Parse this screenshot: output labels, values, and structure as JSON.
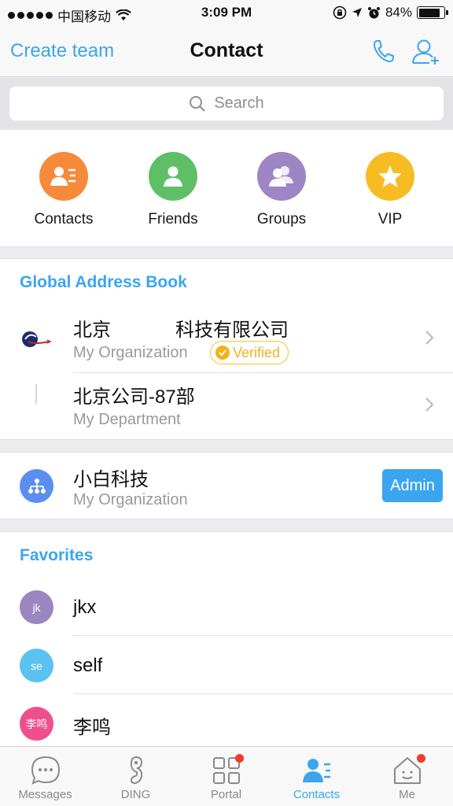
{
  "status_bar": {
    "carrier": "中国移动",
    "time": "3:09 PM",
    "battery_percent": "84%",
    "battery_level": 0.84,
    "icons": [
      "signal-dots-icon",
      "wifi-icon",
      "rotation-lock-icon",
      "location-icon",
      "alarm-icon",
      "battery-icon"
    ]
  },
  "nav": {
    "left_action": "Create team",
    "title": "Contact",
    "right_icons": [
      "phone-icon",
      "add-contact-icon"
    ]
  },
  "search": {
    "placeholder": "Search"
  },
  "quick_actions": [
    {
      "label": "Contacts",
      "color": "#f58a3a",
      "icon": "contacts-icon"
    },
    {
      "label": "Friends",
      "color": "#5fbf67",
      "icon": "friend-icon"
    },
    {
      "label": "Groups",
      "color": "#9c86c4",
      "icon": "groups-icon"
    },
    {
      "label": "VIP",
      "color": "#f6bc22",
      "icon": "star-icon"
    }
  ],
  "global_address_book": {
    "title": "Global Address Book",
    "items": [
      {
        "name_part1": "北京",
        "name_part2": "科技有限公司",
        "subtitle": "My Organization",
        "badge": "Verified"
      },
      {
        "name": "北京公司-87部",
        "subtitle": "My Department"
      }
    ]
  },
  "organization": {
    "name": "小白科技",
    "subtitle": "My Organization",
    "action": "Admin",
    "icon": "org-chart-icon",
    "icon_color": "#5b8ef0"
  },
  "favorites": {
    "title": "Favorites",
    "items": [
      {
        "avatar_text": "jk",
        "name": "jkx",
        "color": "#9a86c0"
      },
      {
        "avatar_text": "se",
        "name": "self",
        "color": "#5cc2f2"
      },
      {
        "avatar_text": "李鸣",
        "name": "李鸣",
        "color": "#ef4f8c"
      }
    ]
  },
  "tab_bar": {
    "items": [
      {
        "label": "Messages",
        "icon": "chat-bubble-icon",
        "active": false,
        "badge": false
      },
      {
        "label": "DING",
        "icon": "ding-icon",
        "active": false,
        "badge": false
      },
      {
        "label": "Portal",
        "icon": "grid-icon",
        "active": false,
        "badge": true
      },
      {
        "label": "Contacts",
        "icon": "contacts-icon",
        "active": true,
        "badge": false
      },
      {
        "label": "Me",
        "icon": "home-face-icon",
        "active": false,
        "badge": true
      }
    ]
  },
  "colors": {
    "accent": "#3ba5f0",
    "verified": "#f3b21b",
    "badge_red": "#f23a30"
  }
}
